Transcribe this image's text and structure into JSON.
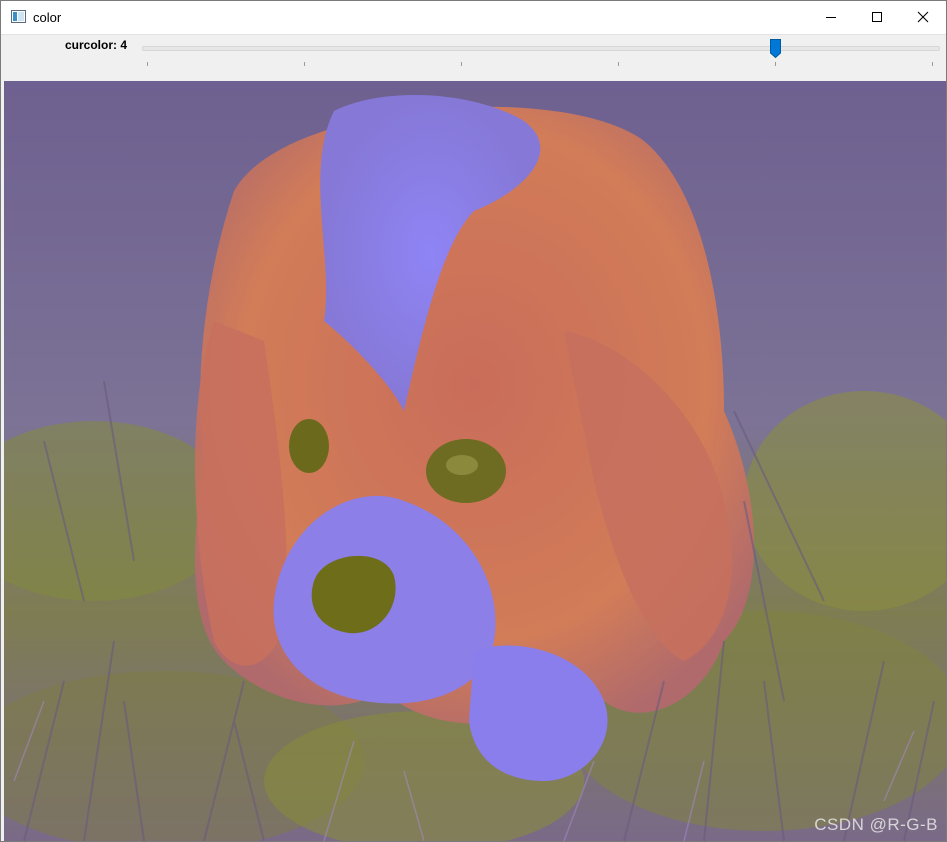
{
  "window": {
    "title": "color",
    "icon": "window-app-icon"
  },
  "controls": {
    "minimize_icon": "minimize-icon",
    "maximize_icon": "maximize-icon",
    "close_icon": "close-icon"
  },
  "trackbar": {
    "label": "curcolor:",
    "value": "4",
    "min": 0,
    "max": 5,
    "current": 4,
    "ticks": [
      0,
      1,
      2,
      3,
      4,
      5
    ],
    "accent": "#0078d7"
  },
  "image": {
    "subject_palette": {
      "grass_purple": "#7e6f9c",
      "grass_olive": "#8a8a3a",
      "fur_orange": "#d37a56",
      "fur_lavender": "#8c7df0",
      "shadow_olive": "#6a6a1e"
    }
  },
  "watermark": "CSDN @R-G-B"
}
